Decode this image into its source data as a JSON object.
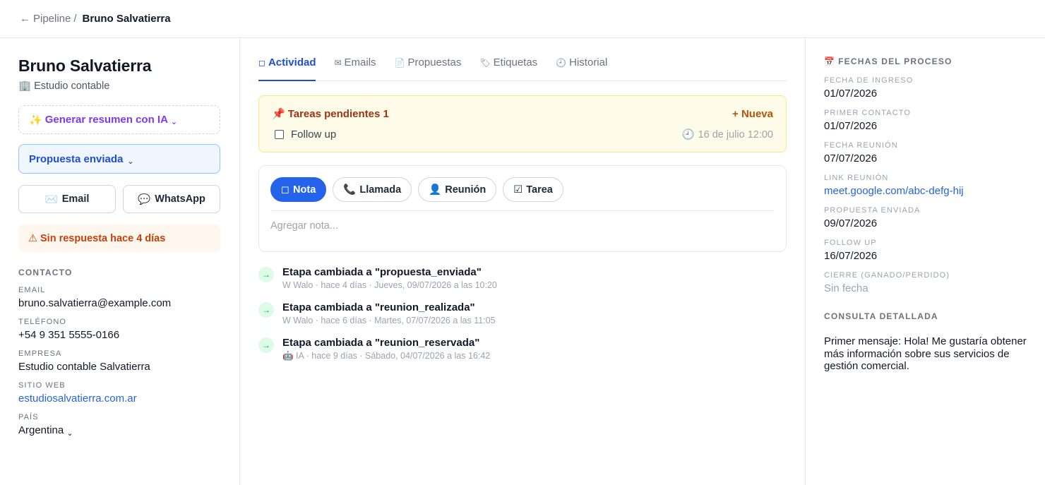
{
  "breadcrumb": {
    "back_icon": "←",
    "parent": "Pipeline",
    "separator": "/",
    "current": "Bruno Salvatierra"
  },
  "contact": {
    "name": "Bruno Salvatierra",
    "company_icon": "🏢",
    "company_short": "Estudio contable",
    "ai_icon": "✨",
    "ai_button": "Generar resumen con IA",
    "chevron": "⌄",
    "stage": "Propuesta enviada",
    "email_icon": "✉️",
    "email_button": "Email",
    "whatsapp_icon": "💬",
    "whatsapp_button": "WhatsApp",
    "warning_icon": "⚠",
    "warning": "Sin respuesta hace 4 días",
    "section_title": "CONTACTO",
    "fields": [
      {
        "label": "EMAIL",
        "value": "bruno.salvatierra@example.com"
      },
      {
        "label": "TELÉFONO",
        "value": "+54 9 351 5555-0166"
      },
      {
        "label": "EMPRESA",
        "value": "Estudio contable Salvatierra"
      },
      {
        "label": "SITIO WEB",
        "value": "estudiosalvatierra.com.ar"
      },
      {
        "label": "PAÍS",
        "value": "Argentina"
      }
    ]
  },
  "tabs": [
    {
      "icon": "◻",
      "label": "Actividad",
      "active": true
    },
    {
      "icon": "✉",
      "label": "Emails"
    },
    {
      "icon": "📄",
      "label": "Propuestas"
    },
    {
      "icon": "🏷",
      "label": "Etiquetas"
    },
    {
      "icon": "🕘",
      "label": "Historial"
    }
  ],
  "tasks": {
    "icon": "📌",
    "title": "Tareas pendientes 1",
    "new_label": "+ Nueva",
    "items": [
      {
        "label": "Follow up",
        "due_icon": "🕘",
        "due": "16 de julio 12:00"
      }
    ]
  },
  "composer": {
    "types": [
      {
        "icon": "◻",
        "label": "Nota",
        "active": true
      },
      {
        "icon": "📞",
        "label": "Llamada"
      },
      {
        "icon": "👤",
        "label": "Reunión"
      },
      {
        "icon": "☑",
        "label": "Tarea"
      }
    ],
    "placeholder": "Agregar nota..."
  },
  "timeline": [
    {
      "icon": "→",
      "title": "Etapa cambiada a \"propuesta_enviada\"",
      "meta": "W Walo · hace 4 días · Jueves, 09/07/2026 a las 10:20"
    },
    {
      "icon": "→",
      "title": "Etapa cambiada a \"reunion_realizada\"",
      "meta": "W Walo · hace 6 días · Martes, 07/07/2026 a las 11:05"
    },
    {
      "icon": "→",
      "title": "Etapa cambiada a \"reunion_reservada\"",
      "meta": "🤖 IA · hace 9 días · Sábado, 04/07/2026 a las 16:42"
    }
  ],
  "dates": {
    "icon": "📅",
    "title": "FECHAS DEL PROCESO",
    "items": [
      {
        "label": "FECHA DE INGRESO",
        "value": "01/07/2026"
      },
      {
        "label": "PRIMER CONTACTO",
        "value": "01/07/2026"
      },
      {
        "label": "FECHA REUNIÓN",
        "value": "07/07/2026"
      },
      {
        "label": "LINK REUNIÓN",
        "value": "meet.google.com/abc-defg-hij"
      },
      {
        "label": "PROPUESTA ENVIADA",
        "value": "09/07/2026"
      },
      {
        "label": "FOLLOW UP",
        "value": "16/07/2026"
      },
      {
        "label": "CIERRE (GANADO/PERDIDO)",
        "value": "Sin fecha"
      }
    ]
  },
  "consulta": {
    "title": "CONSULTA DETALLADA",
    "text": "Primer mensaje: Hola! Me gustaría obtener más información sobre sus servicios de gestión comercial."
  }
}
